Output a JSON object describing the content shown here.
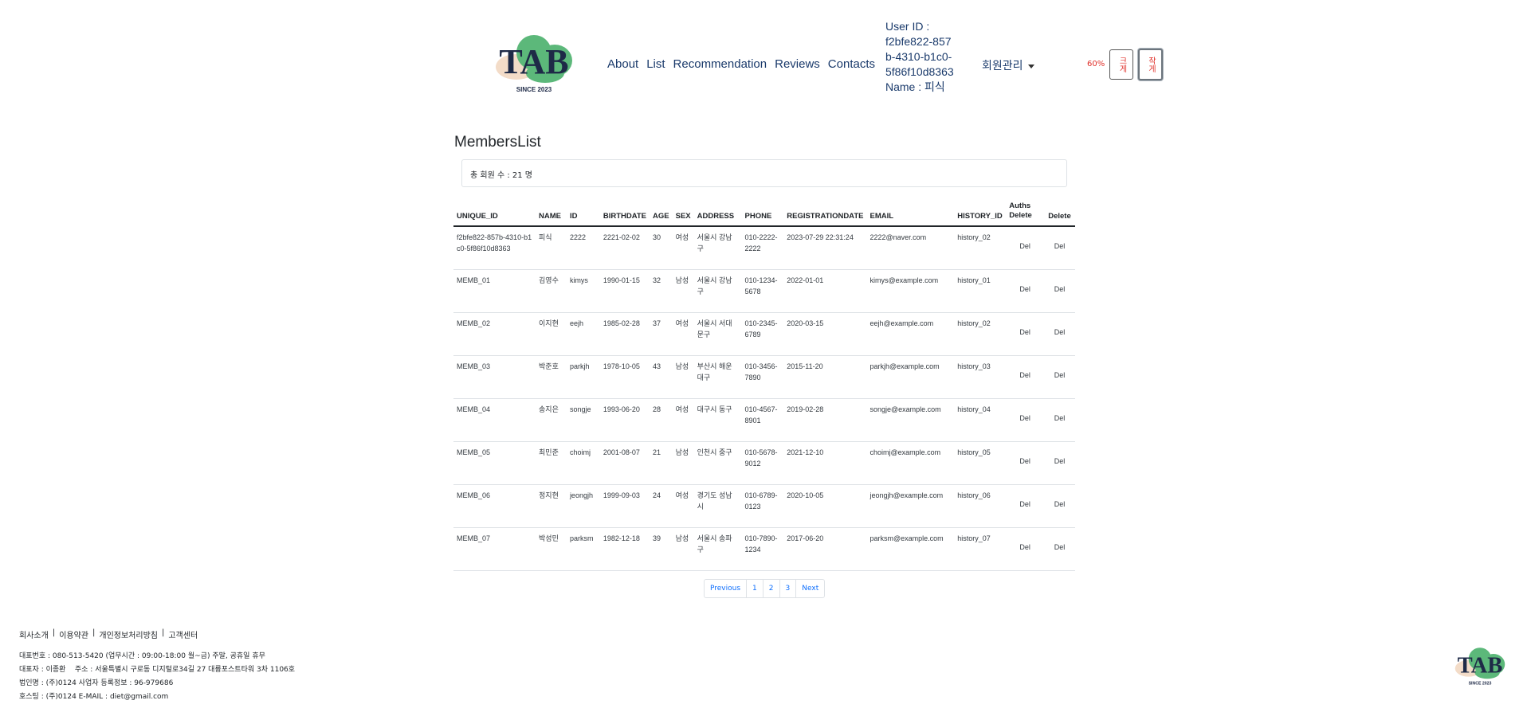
{
  "header": {
    "logo_text": "TAB",
    "logo_sub": "SINCE 2023",
    "nav": [
      "About",
      "List",
      "Recommendation",
      "Reviews",
      "Contacts"
    ],
    "user_id_label": "User ID :",
    "user_id": "f2bfe822-857b-4310-b1c0-5f86f10d8363",
    "name_label": "Name : 피식",
    "member_menu": "회원관리",
    "zoom_level": "60%",
    "zoom_in_label": "크게",
    "zoom_out_label": "작게"
  },
  "main": {
    "title": "MembersList",
    "total_members": "총 회원 수 : 21 명",
    "columns": [
      "UNIQUE_ID",
      "NAME",
      "ID",
      "BIRTHDATE",
      "AGE",
      "SEX",
      "ADDRESS",
      "PHONE",
      "REGISTRATIONDATE",
      "EMAIL",
      "HISTORY_ID",
      "Auths Delete",
      "Delete"
    ],
    "rows": [
      [
        "f2bfe822-857b-4310-b1c0-5f86f10d8363",
        "피식",
        "2222",
        "2221-02-02",
        "30",
        "여성",
        "서울시 강남구",
        "010-2222-2222",
        "2023-07-29 22:31:24",
        "2222@naver.com",
        "history_02",
        "Del",
        "Del"
      ],
      [
        "MEMB_01",
        "김영수",
        "kimys",
        "1990-01-15",
        "32",
        "남성",
        "서울시 강남구",
        "010-1234-5678",
        "2022-01-01",
        "kimys@example.com",
        "history_01",
        "Del",
        "Del"
      ],
      [
        "MEMB_02",
        "이지현",
        "eejh",
        "1985-02-28",
        "37",
        "여성",
        "서울시 서대문구",
        "010-2345-6789",
        "2020-03-15",
        "eejh@example.com",
        "history_02",
        "Del",
        "Del"
      ],
      [
        "MEMB_03",
        "박준호",
        "parkjh",
        "1978-10-05",
        "43",
        "남성",
        "부산시 해운대구",
        "010-3456-7890",
        "2015-11-20",
        "parkjh@example.com",
        "history_03",
        "Del",
        "Del"
      ],
      [
        "MEMB_04",
        "송지은",
        "songje",
        "1993-06-20",
        "28",
        "여성",
        "대구시 동구",
        "010-4567-8901",
        "2019-02-28",
        "songje@example.com",
        "history_04",
        "Del",
        "Del"
      ],
      [
        "MEMB_05",
        "최민준",
        "choimj",
        "2001-08-07",
        "21",
        "남성",
        "인천시 중구",
        "010-5678-9012",
        "2021-12-10",
        "choimj@example.com",
        "history_05",
        "Del",
        "Del"
      ],
      [
        "MEMB_06",
        "정지현",
        "jeongjh",
        "1999-09-03",
        "24",
        "여성",
        "경기도 성남시",
        "010-6789-0123",
        "2020-10-05",
        "jeongjh@example.com",
        "history_06",
        "Del",
        "Del"
      ],
      [
        "MEMB_07",
        "박성민",
        "parksm",
        "1982-12-18",
        "39",
        "남성",
        "서울시 송파구",
        "010-7890-1234",
        "2017-06-20",
        "parksm@example.com",
        "history_07",
        "Del",
        "Del"
      ]
    ],
    "pagination": [
      "Previous",
      "1",
      "2",
      "3",
      "Next"
    ]
  },
  "footer": {
    "links": [
      "회사소개",
      "이용약관",
      "개인정보처리방침",
      "고객센터"
    ],
    "info": [
      "대표번호 : 080-513-5420 (업무시간 : 09:00-18:00 월~금) 주말, 공휴일 휴무",
      "대표자 : 이종환    주소 : 서울특별시 구로동 디지털로34길 27 대륭포스트타워 3차 1106호",
      "법인명 : (주)0124 사업자 등록정보 : 96-979686",
      "호스팅 : (주)0124 E-MAIL : diet@gmail.com"
    ]
  },
  "colors": {
    "nav_text": "#1a3a6b",
    "logo_green": "#5cb87a",
    "logo_peach": "#f3dcc8",
    "logo_navy": "#1e2a47",
    "zoom_red": "#e0302a",
    "link_blue": "#0d6efd"
  }
}
